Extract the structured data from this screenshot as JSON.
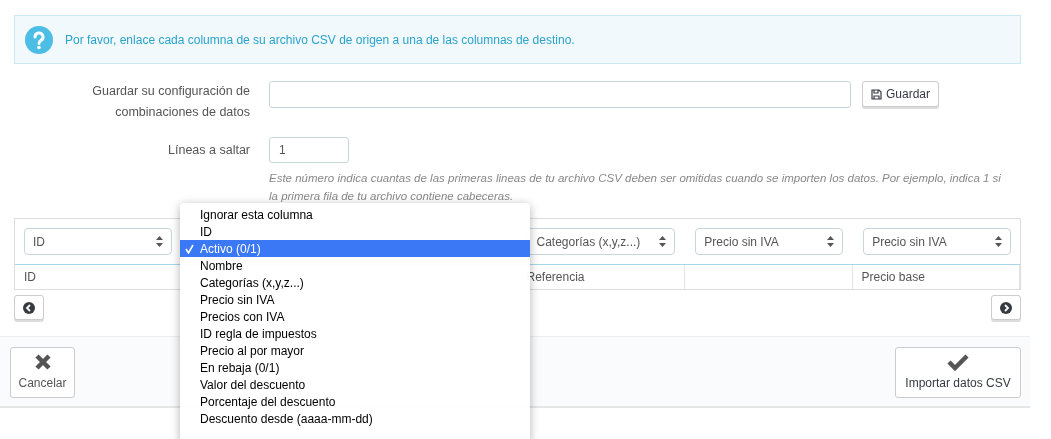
{
  "alert": {
    "text": "Por favor, enlace cada columna de su archivo CSV de origen a una de las columnas de destino."
  },
  "save_config": {
    "label": "Guardar su configuración de combinaciones de datos",
    "button": "Guardar"
  },
  "skip_lines": {
    "label": "Líneas a saltar",
    "value": "1",
    "help": "Este número indica cuantas de las primeras lineas de tu archivo CSV deben ser omitidas cuando se importen los datos. Por ejemplo, indica 1 si la primera fila de tu archivo contiene cabeceras."
  },
  "columns": [
    {
      "select": "ID",
      "cell": "ID"
    },
    {},
    {},
    {
      "select": "Categorías (x,y,z...)",
      "cell": "Referencia"
    },
    {
      "select": "Precio sin IVA"
    },
    {
      "select": "Precio sin IVA",
      "cell": "Precio base"
    }
  ],
  "dropdown": {
    "options": [
      {
        "label": "Ignorar esta columna",
        "selected": false
      },
      {
        "label": "ID",
        "selected": false
      },
      {
        "label": "Activo (0/1)",
        "selected": true
      },
      {
        "label": "Nombre",
        "selected": false
      },
      {
        "label": "Categorías (x,y,z...)",
        "selected": false
      },
      {
        "label": "Precio sin IVA",
        "selected": false
      },
      {
        "label": "Precios con IVA",
        "selected": false
      },
      {
        "label": "ID regla de impuestos",
        "selected": false
      },
      {
        "label": "Precio al por mayor",
        "selected": false
      },
      {
        "label": "En rebaja (0/1)",
        "selected": false
      },
      {
        "label": "Valor del descuento",
        "selected": false
      },
      {
        "label": "Porcentaje del descuento",
        "selected": false
      },
      {
        "label": "Descuento desde (aaaa-mm-dd)",
        "selected": false
      }
    ]
  },
  "footer": {
    "cancel": "Cancelar",
    "import": "Importar datos CSV"
  }
}
